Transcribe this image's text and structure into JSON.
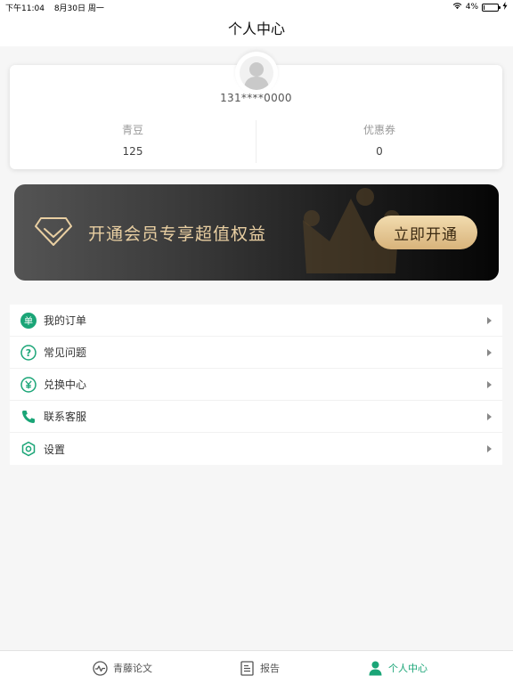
{
  "status_bar": {
    "time": "下午11:04",
    "date": "8月30日 周一",
    "battery": "4%",
    "battery_fraction": 0.04
  },
  "nav": {
    "title": "个人中心"
  },
  "profile": {
    "phone": "131****0000",
    "stats": [
      {
        "label": "青豆",
        "value": "125"
      },
      {
        "label": "优惠券",
        "value": "0"
      }
    ]
  },
  "vip": {
    "text": "开通会员专享超值权益",
    "button": "立即开通"
  },
  "menu": {
    "items": [
      {
        "label": "我的订单",
        "icon": "order-icon"
      },
      {
        "label": "常见问题",
        "icon": "question-icon"
      },
      {
        "label": "兑换中心",
        "icon": "yuan-icon"
      },
      {
        "label": "联系客服",
        "icon": "phone-icon"
      },
      {
        "label": "设置",
        "icon": "settings-icon"
      }
    ]
  },
  "tabs": [
    {
      "label": "青藤论文",
      "icon": "pulse-icon",
      "active": false
    },
    {
      "label": "报告",
      "icon": "report-icon",
      "active": false
    },
    {
      "label": "个人中心",
      "icon": "person-icon",
      "active": true
    }
  ],
  "colors": {
    "accent": "#1aa577",
    "vip_text": "#e9cfa2",
    "vip_button": "#dcb985"
  }
}
